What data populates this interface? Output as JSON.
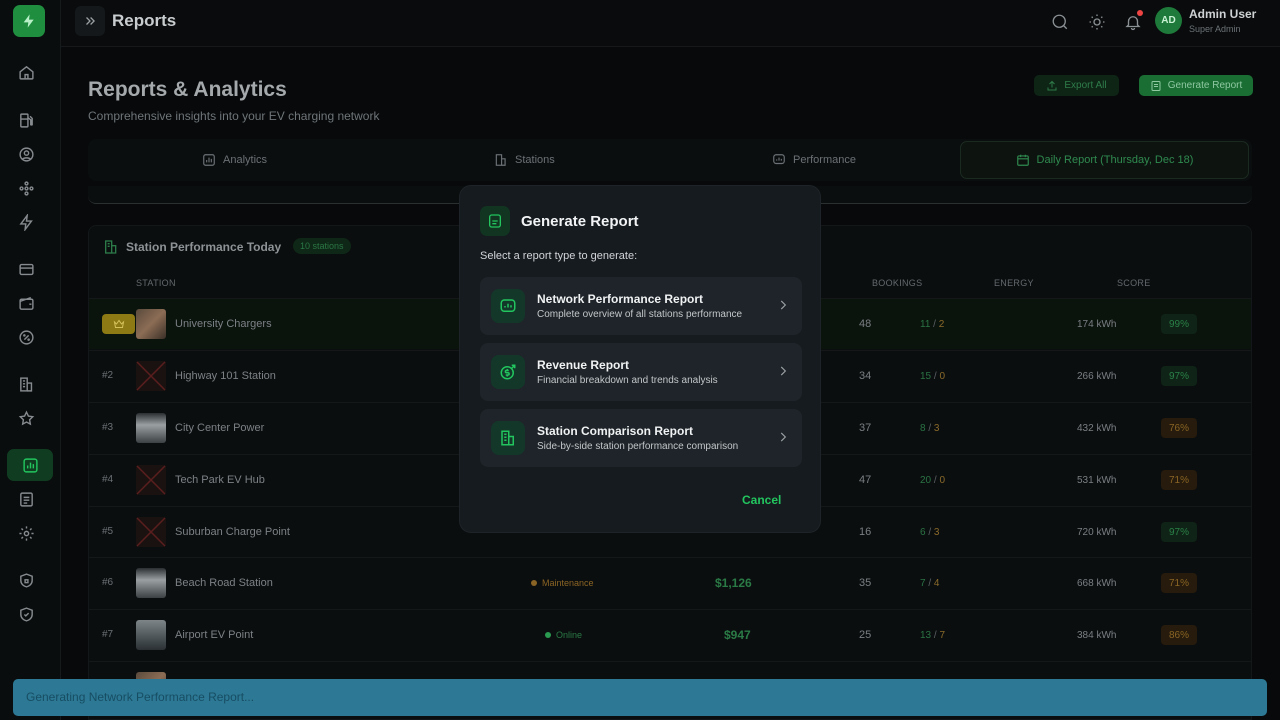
{
  "topbar": {
    "title": "Reports"
  },
  "user": {
    "initials": "AD",
    "name": "Admin User",
    "role": "Super Admin"
  },
  "page": {
    "title": "Reports & Analytics",
    "subtitle": "Comprehensive insights into your EV charging network",
    "export_label": "Export All",
    "generate_label": "Generate Report"
  },
  "tabs": [
    {
      "label": "Analytics"
    },
    {
      "label": "Stations"
    },
    {
      "label": "Performance"
    },
    {
      "label": "Daily Report (Thursday, Dec 18)"
    }
  ],
  "card": {
    "title": "Station Performance Today",
    "badge": "10 stations",
    "columns": {
      "station": "STATION",
      "bookings": "BOOKINGS",
      "energy": "ENERGY",
      "score": "SCORE"
    }
  },
  "rows": [
    {
      "rank": "",
      "name": "University Chargers",
      "status": "",
      "revenue": "",
      "bookings": "48",
      "done": "11",
      "cancel": "2",
      "energy": "174 kWh",
      "score": "99%",
      "tier": "good"
    },
    {
      "rank": "#2",
      "name": "Highway 101 Station",
      "status": "",
      "revenue": "",
      "bookings": "34",
      "done": "15",
      "cancel": "0",
      "energy": "266 kWh",
      "score": "97%",
      "tier": "good"
    },
    {
      "rank": "#3",
      "name": "City Center Power",
      "status": "",
      "revenue": "",
      "bookings": "37",
      "done": "8",
      "cancel": "3",
      "energy": "432 kWh",
      "score": "76%",
      "tier": "mid"
    },
    {
      "rank": "#4",
      "name": "Tech Park EV Hub",
      "status": "",
      "revenue": "",
      "bookings": "47",
      "done": "20",
      "cancel": "0",
      "energy": "531 kWh",
      "score": "71%",
      "tier": "mid"
    },
    {
      "rank": "#5",
      "name": "Suburban Charge Point",
      "status": "",
      "revenue": "",
      "bookings": "16",
      "done": "6",
      "cancel": "3",
      "energy": "720 kWh",
      "score": "97%",
      "tier": "good"
    },
    {
      "rank": "#6",
      "name": "Beach Road Station",
      "status": "Maintenance",
      "revenue": "$1,126",
      "bookings": "35",
      "done": "7",
      "cancel": "4",
      "energy": "668 kWh",
      "score": "71%",
      "tier": "mid"
    },
    {
      "rank": "#7",
      "name": "Airport EV Point",
      "status": "Online",
      "revenue": "$947",
      "bookings": "25",
      "done": "13",
      "cancel": "7",
      "energy": "384 kWh",
      "score": "86%",
      "tier": "mid"
    }
  ],
  "modal": {
    "title": "Generate Report",
    "prompt": "Select a report type to generate:",
    "options": [
      {
        "title": "Network Performance Report",
        "desc": "Complete overview of all stations performance",
        "icon": "chart-icon"
      },
      {
        "title": "Revenue Report",
        "desc": "Financial breakdown and trends analysis",
        "icon": "dollar-trend-icon"
      },
      {
        "title": "Station Comparison Report",
        "desc": "Side-by-side station performance comparison",
        "icon": "building-icon"
      }
    ],
    "cancel_label": "Cancel"
  },
  "toast": {
    "message": "Generating Network Performance Report..."
  },
  "colors": {
    "accent": "#22c55e",
    "toast": "#2d7995",
    "modal_bg": "#161b1f"
  }
}
